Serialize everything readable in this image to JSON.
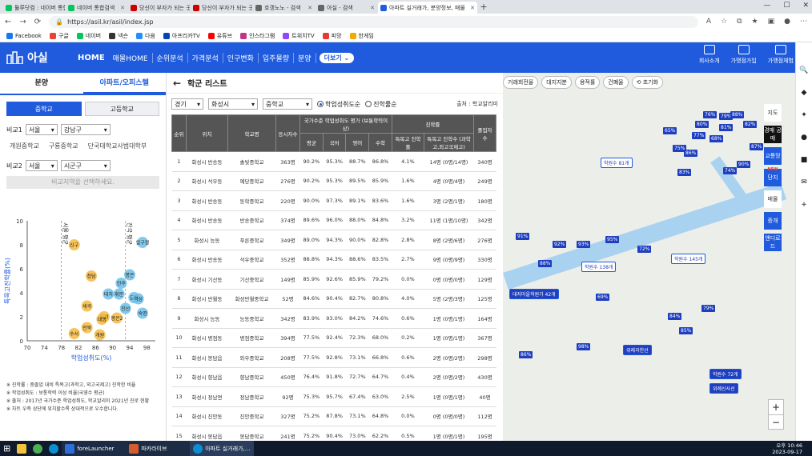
{
  "browser": {
    "tabs": [
      {
        "title": "튤루닷컴 : 네이버 통합검색",
        "color": "#03c75a"
      },
      {
        "title": "네이버 통합검색",
        "color": "#03c75a"
      },
      {
        "title": "당신이 부자가 되는 곳! 월급쟁이",
        "color": "#c00"
      },
      {
        "title": "당신이 부자가 되는 곳! 월급쟁이",
        "color": "#c00"
      },
      {
        "title": "호갱노노 - 검색",
        "color": "#666"
      },
      {
        "title": "아실 - 검색",
        "color": "#666"
      },
      {
        "title": "아파트 실거래가, 분양정보, 매물",
        "color": "#1f5bdc"
      }
    ],
    "url": "https://asil.kr/asil/index.jsp",
    "bookmarks": [
      {
        "label": "Facebook",
        "color": "#1877f2"
      },
      {
        "label": "구글",
        "color": "#ea4335"
      },
      {
        "label": "네이버",
        "color": "#03c75a"
      },
      {
        "label": "넥슨",
        "color": "#333"
      },
      {
        "label": "다음",
        "color": "#1e90ff"
      },
      {
        "label": "아프리카TV",
        "color": "#0545b1"
      },
      {
        "label": "유튜브",
        "color": "#ff0000"
      },
      {
        "label": "인스타그램",
        "color": "#c13584"
      },
      {
        "label": "트위치TV",
        "color": "#9146ff"
      },
      {
        "label": "피망",
        "color": "#e53935"
      },
      {
        "label": "한게임",
        "color": "#f2a900"
      }
    ]
  },
  "site": {
    "logo": "아실",
    "menu": [
      "HOME",
      "매물HOME",
      "순위분석",
      "가격분석",
      "인구변화",
      "입주물량",
      "분양"
    ],
    "more": "더보기",
    "right": [
      "회사소개",
      "가맹점가입",
      "가맹점체험"
    ]
  },
  "left": {
    "tabs": [
      "분양",
      "아파트/오피스텔"
    ],
    "school_types": [
      "중학교",
      "고등학교"
    ],
    "compare1": {
      "label": "비교1",
      "city": "서울",
      "district": "강남구"
    },
    "schools": [
      "개원중학교",
      "구룡중학교",
      "단국대학교사범대학부"
    ],
    "compare2": {
      "label": "비교2",
      "city": "서울",
      "district": "시군구"
    },
    "compare_btn": "비교지역을 선택하세요.",
    "notes": [
      "※ 진학률 : 중졸업 대비 특목고(과학고, 외고국제고) 진학한 비율",
      "※ 학업성취도 : 보통학력 이상 비율(국영수 평균)",
      "※ 출처 : 2017년 국가수준 학업성취도, 학교알리미 2021년 진로 현황",
      "※ 차트 우측 상단에 위치할수록 상대적으로 우수합니다."
    ]
  },
  "chart_data": {
    "type": "scatter",
    "xlabel": "학업성취도(%)",
    "ylabel": "특목고진학률(%)",
    "xlim": [
      70,
      100
    ],
    "ylim": [
      0,
      10
    ],
    "xticks": [
      70,
      74,
      78,
      82,
      86,
      90,
      94,
      98
    ],
    "yticks": [
      0,
      2,
      4,
      6,
      8,
      10
    ],
    "vlines": [
      {
        "x": 78,
        "label": "서울 평균"
      },
      {
        "x": 93,
        "label": "전국 평균"
      }
    ],
    "points": [
      {
        "name": "압구정",
        "x": 97,
        "y": 8.2
      },
      {
        "name": "신구",
        "x": 81,
        "y": 8.0
      },
      {
        "name": "청담",
        "x": 85,
        "y": 5.4
      },
      {
        "name": "봉은",
        "x": 94,
        "y": 5.5
      },
      {
        "name": "언주",
        "x": 92,
        "y": 4.8
      },
      {
        "name": "대치",
        "x": 89,
        "y": 3.9
      },
      {
        "name": "휘문",
        "x": 91.5,
        "y": 3.9
      },
      {
        "name": "도곡",
        "x": 95,
        "y": 3.6
      },
      {
        "name": "역삼",
        "x": 96,
        "y": 3.5
      },
      {
        "name": "세곡",
        "x": 84,
        "y": 2.9
      },
      {
        "name": "진선",
        "x": 93,
        "y": 2.7
      },
      {
        "name": "숙명",
        "x": 97,
        "y": 2.3
      },
      {
        "name": "동원",
        "x": 88,
        "y": 2.0
      },
      {
        "name": "대명",
        "x": 87.5,
        "y": 1.8
      },
      {
        "name": "언북",
        "x": 84,
        "y": 1.1
      },
      {
        "name": "수서",
        "x": 81,
        "y": 0.6
      },
      {
        "name": "개원",
        "x": 87,
        "y": 0.5
      },
      {
        "name": "봉은2",
        "x": 91,
        "y": 1.9
      }
    ]
  },
  "main": {
    "title": "학군 리스트",
    "filter1": "경기",
    "filter2": "화성시",
    "filter3": "중학교",
    "sort_options": [
      "학업성취도순",
      "진학률순"
    ],
    "source": "출처 : 학교알리미",
    "headers": [
      "순위",
      "위치",
      "학교명",
      "응시자수",
      "국가수준 학업성취도 평가 (보통학력이상)",
      "평균",
      "국어",
      "영어",
      "수학",
      "진학률",
      "특목고 진학률",
      "특목고 진학수 (과학고,외고국제고)",
      "졸업자 수"
    ],
    "rows": [
      [
        "1",
        "화성시 반송동",
        "솔빛중학교",
        "363명",
        "90.2%",
        "95.3%",
        "88.7%",
        "86.8%",
        "4.1%",
        "14명 (0명/14명)",
        "340명"
      ],
      [
        "2",
        "화성시 석우동",
        "예당중학교",
        "276명",
        "90.2%",
        "95.3%",
        "89.5%",
        "85.9%",
        "1.6%",
        "4명 (0명/4명)",
        "249명"
      ],
      [
        "3",
        "화성시 반송동",
        "동학중학교",
        "220명",
        "90.0%",
        "97.3%",
        "89.1%",
        "83.6%",
        "1.6%",
        "3명 (2명/1명)",
        "180명"
      ],
      [
        "4",
        "화성시 반송동",
        "반송중학교",
        "374명",
        "89.6%",
        "96.0%",
        "88.0%",
        "84.8%",
        "3.2%",
        "11명 (1명/10명)",
        "342명"
      ],
      [
        "5",
        "화성시 능동",
        "푸른중학교",
        "349명",
        "89.0%",
        "94.3%",
        "90.0%",
        "82.8%",
        "2.8%",
        "8명 (2명/6명)",
        "276명"
      ],
      [
        "6",
        "화성시 반송동",
        "석우중학교",
        "352명",
        "88.8%",
        "94.3%",
        "88.6%",
        "83.5%",
        "2.7%",
        "9명 (0명/9명)",
        "330명"
      ],
      [
        "7",
        "화성시 기산동",
        "기산중학교",
        "149명",
        "85.9%",
        "92.6%",
        "85.9%",
        "79.2%",
        "0.0%",
        "0명 (0명/0명)",
        "129명"
      ],
      [
        "8",
        "화성시 반월동",
        "화성반월중학교",
        "52명",
        "84.6%",
        "90.4%",
        "82.7%",
        "80.8%",
        "4.0%",
        "5명 (2명/3명)",
        "125명"
      ],
      [
        "9",
        "화성시 능동",
        "능동중학교",
        "342명",
        "83.9%",
        "93.0%",
        "84.2%",
        "74.6%",
        "0.6%",
        "1명 (0명/1명)",
        "164명"
      ],
      [
        "10",
        "화성시 병점동",
        "병점중학교",
        "394명",
        "77.5%",
        "92.4%",
        "72.3%",
        "68.0%",
        "0.2%",
        "1명 (0명/1명)",
        "367명"
      ],
      [
        "11",
        "화성시 봉담읍",
        "와우중학교",
        "208명",
        "77.5%",
        "92.8%",
        "73.1%",
        "66.8%",
        "0.6%",
        "2명 (0명/2명)",
        "298명"
      ],
      [
        "12",
        "화성시 향남읍",
        "향남중학교",
        "450명",
        "76.4%",
        "91.8%",
        "72.7%",
        "64.7%",
        "0.4%",
        "2명 (0명/2명)",
        "430명"
      ],
      [
        "13",
        "화성시 정남면",
        "정남중학교",
        "92명",
        "75.3%",
        "95.7%",
        "67.4%",
        "63.0%",
        "2.5%",
        "1명 (0명/1명)",
        "40명"
      ],
      [
        "14",
        "화성시 진안동",
        "진안중학교",
        "327명",
        "75.2%",
        "87.8%",
        "73.1%",
        "64.8%",
        "0.0%",
        "0명 (0명/0명)",
        "112명"
      ],
      [
        "15",
        "화성시 봉담읍",
        "봉담중학교",
        "241명",
        "75.2%",
        "90.4%",
        "73.0%",
        "62.2%",
        "0.5%",
        "1명 (0명/1명)",
        "195명"
      ]
    ]
  },
  "map": {
    "tools": [
      "거래회전율",
      "대지지분",
      "용적률",
      "건폐율",
      "초기화"
    ],
    "side": [
      "지도",
      "경매 공매",
      "교통망",
      "단지",
      "매물",
      "증개",
      "앤디로드"
    ],
    "side_badge": "NEW",
    "pins": [
      "76%",
      "79%",
      "88%",
      "80%",
      "68%",
      "81%",
      "82%",
      "87%",
      "90%",
      "77%",
      "65%",
      "75%",
      "86%",
      "74%",
      "83%",
      "91%",
      "92%",
      "93%",
      "95%",
      "72%",
      "69%",
      "88%",
      "84%",
      "85%",
      "79%",
      "98%",
      "86%"
    ],
    "bubbles": [
      "학원수 81개",
      "학원수 138개",
      "학원수 145개",
      "대지마을학원가 42개",
      "학원수 72개"
    ],
    "stations": [
      "위례과천선",
      "위례신사선"
    ],
    "zoom_in": "+",
    "zoom_out": "−"
  },
  "taskbar": {
    "apps": [
      "foreLauncher",
      "파카라이브",
      "아파트 실거래가,..."
    ],
    "time": "오후 10:46",
    "date": "2023-09-17"
  }
}
